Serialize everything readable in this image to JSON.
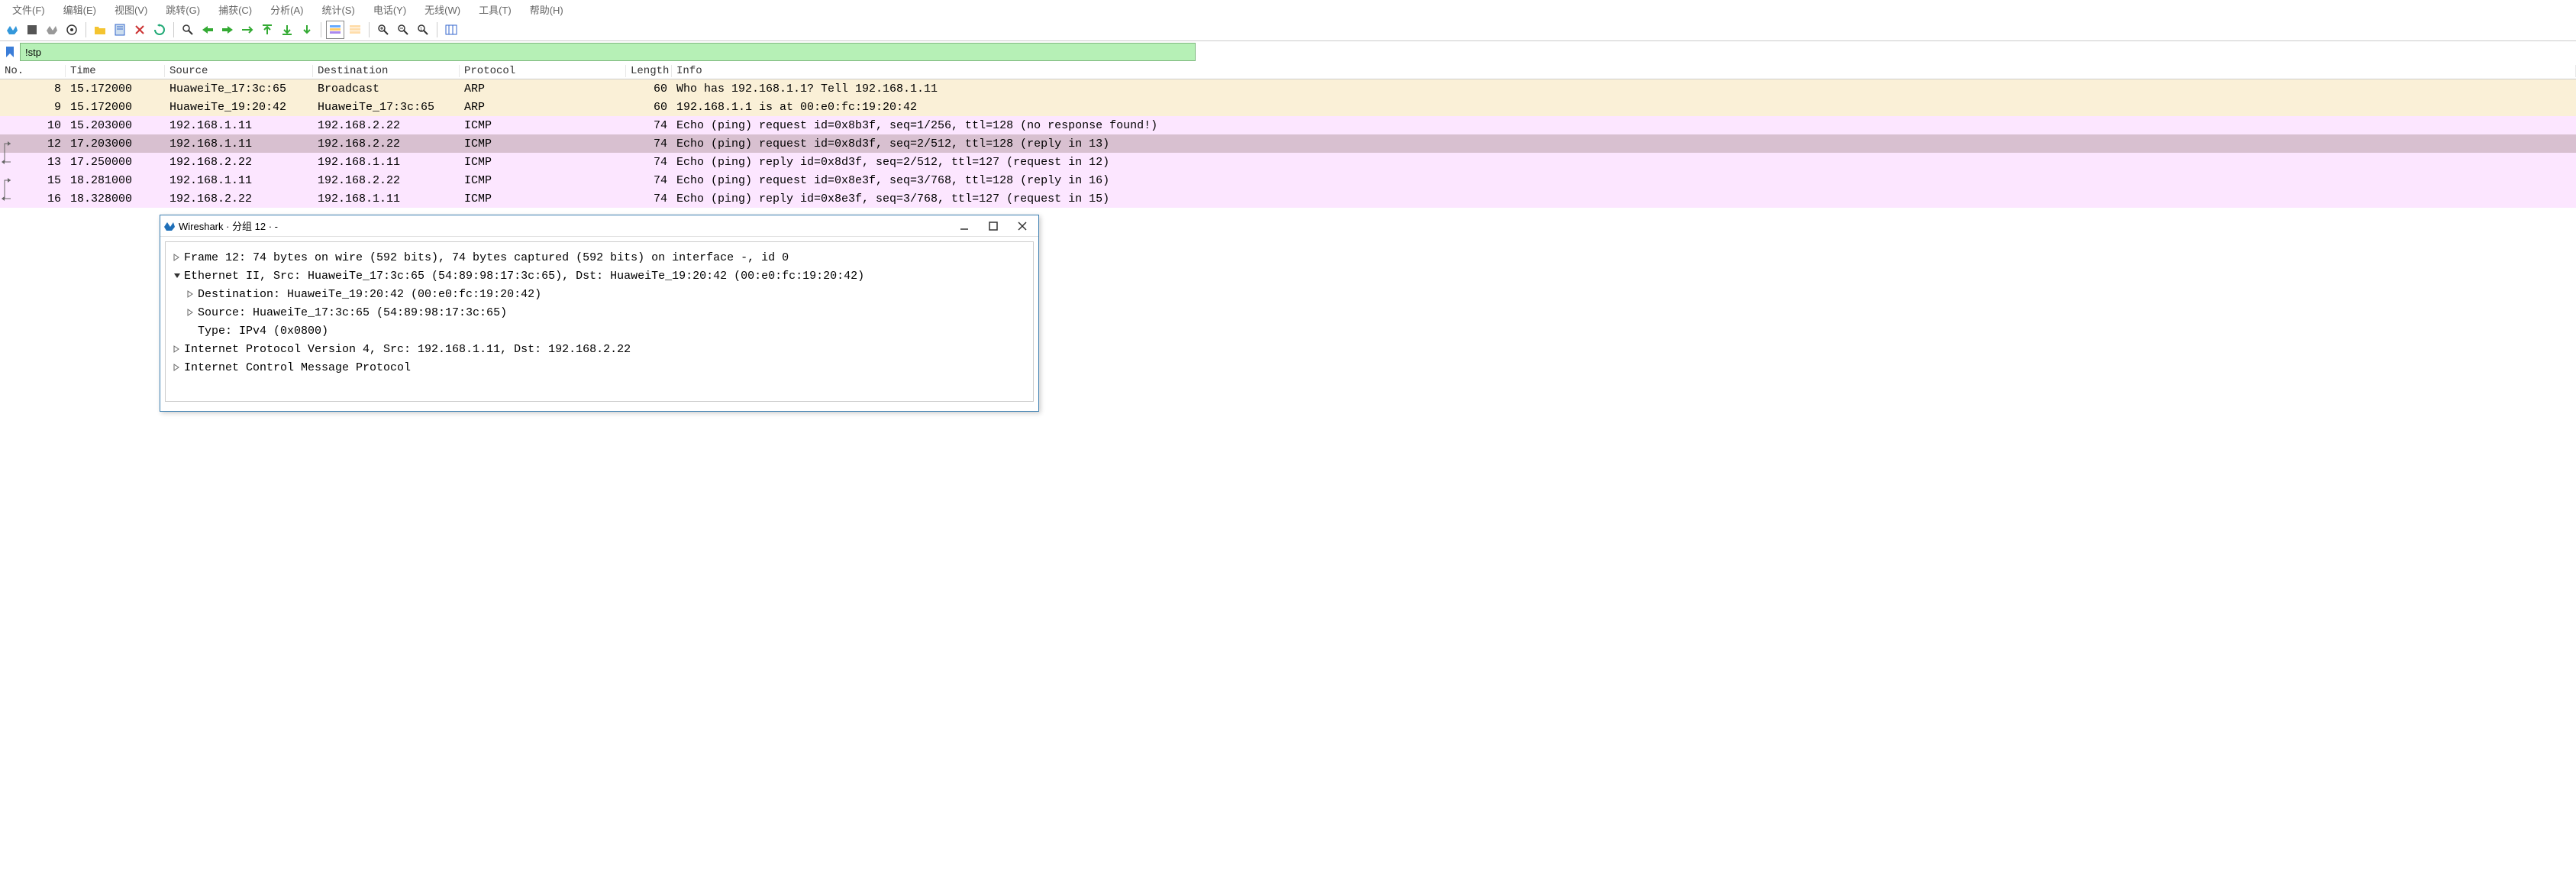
{
  "menu": [
    "文件(F)",
    "编辑(E)",
    "视图(V)",
    "跳转(G)",
    "捕获(C)",
    "分析(A)",
    "统计(S)",
    "电话(Y)",
    "无线(W)",
    "工具(T)",
    "帮助(H)"
  ],
  "filter": {
    "value": "!stp"
  },
  "columns": {
    "no": "No.",
    "time": "Time",
    "source": "Source",
    "dest": "Destination",
    "proto": "Protocol",
    "len": "Length",
    "info": "Info"
  },
  "packets": [
    {
      "no": "8",
      "time": "15.172000",
      "src": "HuaweiTe_17:3c:65",
      "dst": "Broadcast",
      "proto": "ARP",
      "len": "60",
      "info": "Who has 192.168.1.1? Tell 192.168.1.11",
      "cls": "arp",
      "link": ""
    },
    {
      "no": "9",
      "time": "15.172000",
      "src": "HuaweiTe_19:20:42",
      "dst": "HuaweiTe_17:3c:65",
      "proto": "ARP",
      "len": "60",
      "info": "192.168.1.1 is at 00:e0:fc:19:20:42",
      "cls": "arp",
      "link": ""
    },
    {
      "no": "10",
      "time": "15.203000",
      "src": "192.168.1.11",
      "dst": "192.168.2.22",
      "proto": "ICMP",
      "len": "74",
      "info": "Echo (ping) request  id=0x8b3f, seq=1/256, ttl=128 (no response found!)",
      "cls": "icmp",
      "link": ""
    },
    {
      "no": "12",
      "time": "17.203000",
      "src": "192.168.1.11",
      "dst": "192.168.2.22",
      "proto": "ICMP",
      "len": "74",
      "info": "Echo (ping) request  id=0x8d3f, seq=2/512, ttl=128 (reply in 13)",
      "cls": "sel",
      "link": "down"
    },
    {
      "no": "13",
      "time": "17.250000",
      "src": "192.168.2.22",
      "dst": "192.168.1.11",
      "proto": "ICMP",
      "len": "74",
      "info": "Echo (ping) reply    id=0x8d3f, seq=2/512, ttl=127 (request in 12)",
      "cls": "icmp",
      "link": "up"
    },
    {
      "no": "15",
      "time": "18.281000",
      "src": "192.168.1.11",
      "dst": "192.168.2.22",
      "proto": "ICMP",
      "len": "74",
      "info": "Echo (ping) request  id=0x8e3f, seq=3/768, ttl=128 (reply in 16)",
      "cls": "icmp",
      "link": "down2"
    },
    {
      "no": "16",
      "time": "18.328000",
      "src": "192.168.2.22",
      "dst": "192.168.1.11",
      "proto": "ICMP",
      "len": "74",
      "info": "Echo (ping) reply    id=0x8e3f, seq=3/768, ttl=127 (request in 15)",
      "cls": "icmp",
      "link": "up2"
    }
  ],
  "popup": {
    "title": "Wireshark · 分组 12 · -",
    "tree": [
      {
        "ind": 0,
        "arrow": "right",
        "text": "Frame 12: 74 bytes on wire (592 bits), 74 bytes captured (592 bits) on interface -, id 0"
      },
      {
        "ind": 0,
        "arrow": "down",
        "text": "Ethernet II, Src: HuaweiTe_17:3c:65 (54:89:98:17:3c:65), Dst: HuaweiTe_19:20:42 (00:e0:fc:19:20:42)"
      },
      {
        "ind": 1,
        "arrow": "right",
        "text": "Destination: HuaweiTe_19:20:42 (00:e0:fc:19:20:42)"
      },
      {
        "ind": 1,
        "arrow": "right",
        "text": "Source: HuaweiTe_17:3c:65 (54:89:98:17:3c:65)"
      },
      {
        "ind": 1,
        "arrow": "",
        "text": "Type: IPv4 (0x0800)"
      },
      {
        "ind": 0,
        "arrow": "right",
        "text": "Internet Protocol Version 4, Src: 192.168.1.11, Dst: 192.168.2.22"
      },
      {
        "ind": 0,
        "arrow": "right",
        "text": "Internet Control Message Protocol"
      }
    ]
  },
  "icons": {
    "fin": "#1e90ff",
    "toolbar": [
      "fin",
      "stop",
      "restart",
      "gear",
      "",
      "folder",
      "save",
      "close",
      "reload",
      "",
      "find",
      "back",
      "forward",
      "jump",
      "gotop",
      "gobottom",
      "download",
      "",
      "autoscroll",
      "colorize",
      "",
      "zoomin",
      "zoomout",
      "zoomreset",
      "columns"
    ]
  }
}
